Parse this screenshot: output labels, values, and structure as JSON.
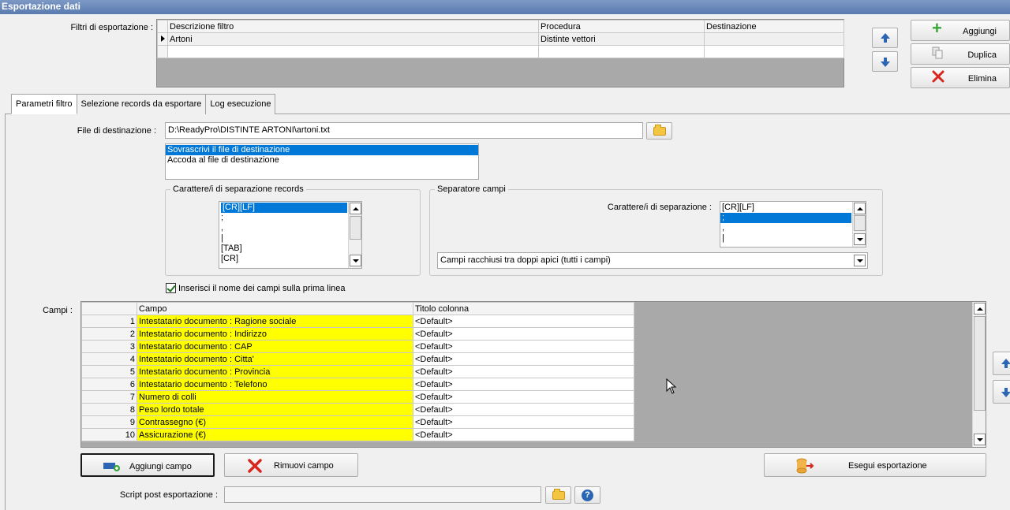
{
  "window": {
    "title": "Esportazione dati"
  },
  "filters": {
    "label": "Filtri di esportazione :",
    "columns": [
      "Descrizione filtro",
      "Procedura",
      "Destinazione"
    ],
    "rows": [
      {
        "descrizione": "Artoni",
        "procedura": "Distinte vettori",
        "destinazione": ""
      },
      {
        "descrizione": "",
        "procedura": "",
        "destinazione": ""
      }
    ]
  },
  "side_buttons": {
    "add": "Aggiungi",
    "duplicate": "Duplica",
    "delete": "Elimina"
  },
  "tabs": [
    "Parametri filtro",
    "Selezione records da esportare",
    "Log esecuzione"
  ],
  "destination": {
    "label": "File di destinazione :",
    "value": "D:\\ReadyPro\\DISTINTE ARTONI\\artoni.txt",
    "mode_options": [
      "Sovrascrivi il file di destinazione",
      "Accoda al file di destinazione"
    ],
    "mode_selected": 0
  },
  "record_separator": {
    "title": "Carattere/i di separazione records",
    "options": [
      "[CR][LF]",
      ";",
      ",",
      "|",
      "[TAB]",
      "[CR]"
    ],
    "selected": 0
  },
  "field_separator": {
    "title": "Separatore campi",
    "label": "Carattere/i di separazione :",
    "options": [
      "[CR][LF]",
      ";",
      ",",
      "|"
    ],
    "selected": 1,
    "quote_mode": "Campi racchiusi tra doppi apici (tutti i campi)"
  },
  "header_checkbox": {
    "label": "Inserisci il nome dei campi sulla prima linea",
    "checked": true
  },
  "fields": {
    "label": "Campi :",
    "columns": [
      "Campo",
      "Titolo colonna"
    ],
    "rows": [
      {
        "n": "1",
        "campo": "Intestatario documento : Ragione sociale",
        "titolo": "<Default>"
      },
      {
        "n": "2",
        "campo": "Intestatario documento : Indirizzo",
        "titolo": "<Default>"
      },
      {
        "n": "3",
        "campo": "Intestatario documento : CAP",
        "titolo": "<Default>"
      },
      {
        "n": "4",
        "campo": "Intestatario documento : Citta'",
        "titolo": "<Default>"
      },
      {
        "n": "5",
        "campo": "Intestatario documento : Provincia",
        "titolo": "<Default>"
      },
      {
        "n": "6",
        "campo": "Intestatario documento : Telefono",
        "titolo": "<Default>"
      },
      {
        "n": "7",
        "campo": "Numero di colli",
        "titolo": "<Default>"
      },
      {
        "n": "8",
        "campo": "Peso lordo totale",
        "titolo": "<Default>"
      },
      {
        "n": "9",
        "campo": "Contrassegno (€)",
        "titolo": "<Default>"
      },
      {
        "n": "10",
        "campo": "Assicurazione (€)",
        "titolo": "<Default>"
      }
    ]
  },
  "actions": {
    "add_field": "Aggiungi campo",
    "remove_field": "Rimuovi campo",
    "run_export": "Esegui esportazione"
  },
  "script": {
    "label": "Script post esportazione :",
    "value": ""
  },
  "colors": {
    "highlight": "#ffff00",
    "selection": "#0078d7",
    "titlebar": "#6a89bb"
  }
}
